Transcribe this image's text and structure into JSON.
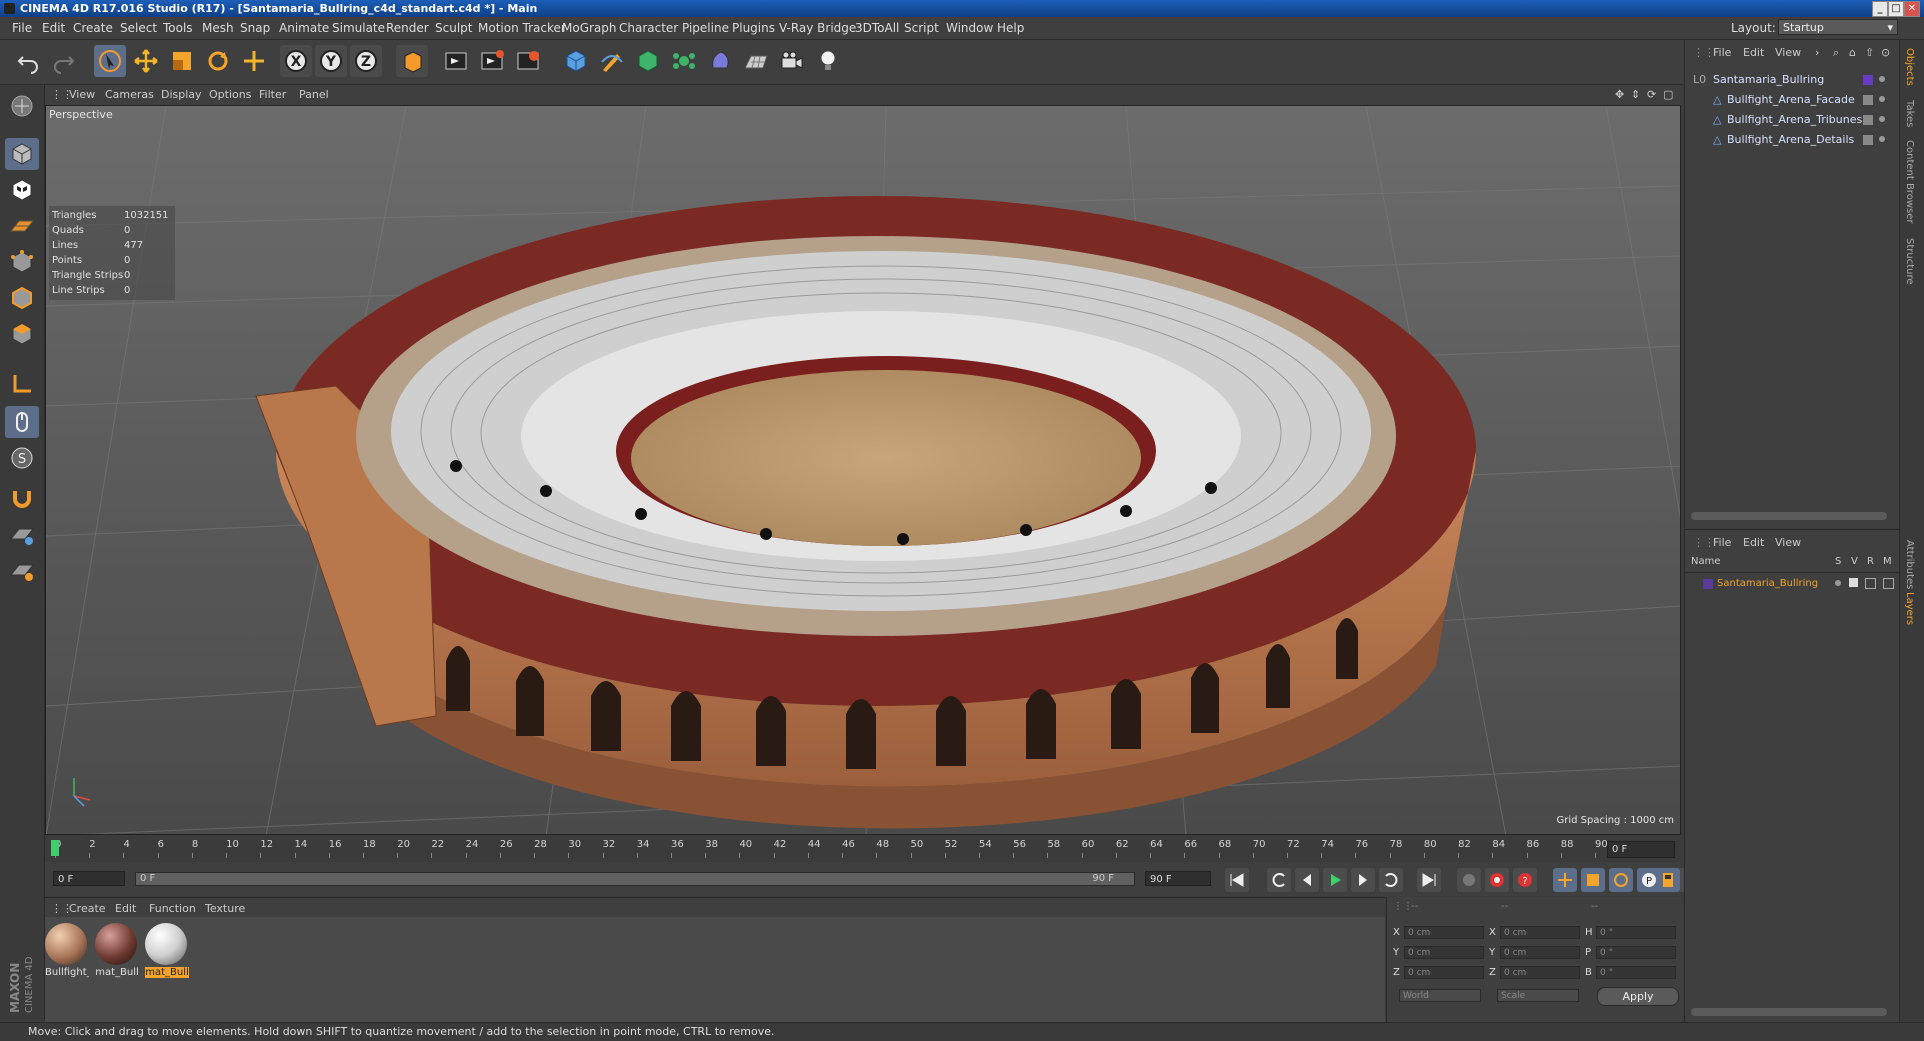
{
  "window": {
    "title": "CINEMA 4D R17.016 Studio (R17) - [Santamaria_Bullring_c4d_standart.c4d *] - Main",
    "minimize": "_",
    "maximize": "□",
    "close": "✕"
  },
  "menubar": {
    "items": [
      "File",
      "Edit",
      "Create",
      "Select",
      "Tools",
      "Mesh",
      "Snap",
      "Animate",
      "Simulate",
      "Render",
      "Sculpt",
      "Motion Tracker",
      "MoGraph",
      "Character",
      "Pipeline",
      "Plugins",
      "V-Ray Bridge",
      "3DToAll",
      "Script",
      "Window",
      "Help"
    ],
    "layout_label": "Layout:",
    "layout_value": "Startup"
  },
  "toolbar": {
    "icons": [
      "undo-icon",
      "redo-icon",
      "live-selection-icon",
      "move-icon",
      "scale-icon",
      "rotate-icon",
      "recent-tools-icon",
      "x-axis-icon",
      "y-axis-icon",
      "z-axis-icon",
      "world-coordinates-icon",
      "render-view-icon",
      "render-picture-viewer-icon",
      "edit-render-settings-icon",
      "cube-icon",
      "pen-icon",
      "subdivision-icon",
      "cloner-icon",
      "deformer-icon",
      "floor-icon",
      "camera-icon",
      "light-icon"
    ]
  },
  "left_tools": {
    "icons": [
      "make-editable-icon",
      "model-mode-icon",
      "texture-mode-icon",
      "workplane-icon",
      "points-mode-icon",
      "edges-mode-icon",
      "polygons-mode-icon",
      "axis-mode-icon",
      "tweak-mode-icon",
      "solo-icon",
      "magnet-icon",
      "snap-icon",
      "snap-settings-icon"
    ]
  },
  "viewport": {
    "menu": [
      "View",
      "Cameras",
      "Display",
      "Options",
      "Filter",
      "Panel"
    ],
    "camera_label": "Perspective",
    "stats": [
      {
        "label": "Triangles",
        "value": "1032151"
      },
      {
        "label": "Quads",
        "value": "0"
      },
      {
        "label": "Lines",
        "value": "477"
      },
      {
        "label": "Points",
        "value": "0"
      },
      {
        "label": "Triangle Strips",
        "value": "0"
      },
      {
        "label": "Line Strips",
        "value": "0"
      }
    ],
    "grid_spacing": "Grid Spacing : 1000 cm",
    "nav_icons": [
      "move-view-icon",
      "zoom-view-icon",
      "rotate-view-icon",
      "maximize-view-icon"
    ]
  },
  "timeline": {
    "ticks": [
      "0",
      "2",
      "4",
      "6",
      "8",
      "10",
      "12",
      "14",
      "16",
      "18",
      "20",
      "22",
      "24",
      "26",
      "28",
      "30",
      "32",
      "34",
      "36",
      "38",
      "40",
      "42",
      "44",
      "46",
      "48",
      "50",
      "52",
      "54",
      "56",
      "58",
      "60",
      "62",
      "64",
      "66",
      "68",
      "70",
      "72",
      "74",
      "76",
      "78",
      "80",
      "82",
      "84",
      "86",
      "88",
      "90"
    ],
    "current_frame": "0 F"
  },
  "transport": {
    "start_frame": "0 F",
    "range_start": "0 F",
    "range_end": "90 F",
    "end_frame": "90 F",
    "buttons": [
      "go-to-start-icon",
      "previous-key-icon",
      "previous-frame-icon",
      "play-icon",
      "next-frame-icon",
      "next-key-icon",
      "go-to-end-icon"
    ],
    "record_buttons": [
      "motion-record-icon",
      "record-active-icon",
      "autokey-icon",
      "keyframe-selection-icon",
      "position-key-icon",
      "scale-key-icon",
      "rotation-key-icon",
      "parameter-key-icon",
      "pla-key-icon",
      "timeline-icon"
    ]
  },
  "materials": {
    "menu": [
      "Create",
      "Edit",
      "Function",
      "Texture"
    ],
    "items": [
      {
        "name": "Bullfight_",
        "selected": false,
        "color": "#a87558"
      },
      {
        "name": "mat_Bull",
        "selected": false,
        "color": "#6e3a30"
      },
      {
        "name": "mat_Bull",
        "selected": true,
        "color": "#cfcfcf"
      }
    ]
  },
  "coordinates": {
    "header": [
      "--",
      "--",
      "--"
    ],
    "rows": [
      {
        "a": "X",
        "av": "0 cm",
        "b": "X",
        "bv": "0 cm",
        "c": "H",
        "cv": "0 °"
      },
      {
        "a": "Y",
        "av": "0 cm",
        "b": "Y",
        "bv": "0 cm",
        "c": "P",
        "cv": "0 °"
      },
      {
        "a": "Z",
        "av": "0 cm",
        "b": "Z",
        "bv": "0 cm",
        "c": "B",
        "cv": "0 °"
      }
    ],
    "mode1": "World",
    "mode2": "Scale",
    "apply": "Apply"
  },
  "status": "Move: Click and drag to move elements. Hold down SHIFT to quantize movement / add to the selection in point mode, CTRL to remove.",
  "object_manager": {
    "menu": [
      "File",
      "Edit",
      "View"
    ],
    "objects": [
      {
        "name": "Santamaria_Bullring",
        "level": 0
      },
      {
        "name": "Bullfight_Arena_Facade",
        "level": 1
      },
      {
        "name": "Bullfight_Arena_Tribunes",
        "level": 1
      },
      {
        "name": "Bullfight_Arena_Details",
        "level": 1
      }
    ]
  },
  "layer_manager": {
    "menu": [
      "File",
      "Edit",
      "View"
    ],
    "columns": [
      "Name",
      "S",
      "V",
      "R",
      "M"
    ],
    "layers": [
      {
        "name": "Santamaria_Bullring",
        "color": "#5a3a9a"
      }
    ]
  },
  "side_tabs": {
    "top": [
      "Objects",
      "Takes",
      "Content Browser",
      "Structure"
    ],
    "bottom": [
      "Attributes",
      "Layers"
    ]
  },
  "brand": "MAXON CINEMA 4D"
}
